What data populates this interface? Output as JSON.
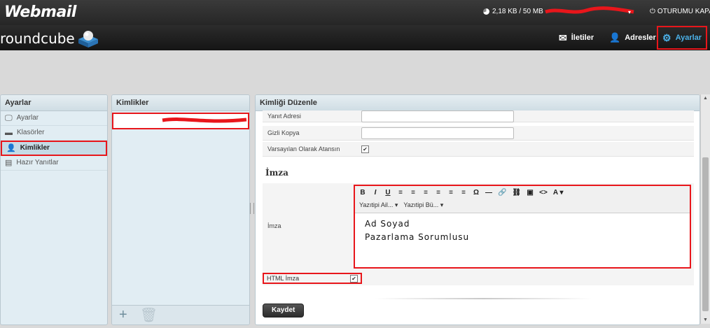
{
  "app": {
    "brand": "Webmail",
    "logo": "roundcube"
  },
  "topbar": {
    "quota": "2,18 KB / 50 MB",
    "logout": "OTURUMU KAPAT"
  },
  "nav": {
    "messages": "İletiler",
    "contacts": "Adresler",
    "settings": "Ayarlar"
  },
  "left_panel": {
    "title": "Ayarlar",
    "items": [
      {
        "label": "Ayarlar",
        "icon": "monitor-icon"
      },
      {
        "label": "Klasörler",
        "icon": "folder-icon"
      },
      {
        "label": "Kimlikler",
        "icon": "person-icon",
        "selected": true
      },
      {
        "label": "Hazır Yanıtlar",
        "icon": "document-icon"
      }
    ]
  },
  "mid_panel": {
    "title": "Kimlikler"
  },
  "right_panel": {
    "title": "Kimliği Düzenle",
    "fields": {
      "reply_to": "Yanıt Adresi",
      "bcc": "Gizli Kopya",
      "default": "Varsayılan Olarak Atansın"
    },
    "section_title": "İmza",
    "signature_label": "İmza",
    "toolbar": {
      "row1": [
        "B",
        "I",
        "U",
        "≡",
        "≡",
        "≡",
        "≡",
        "≡",
        "≡",
        "Ω",
        "—",
        "🔗",
        "⛓",
        "▣",
        "<>",
        "A ▾"
      ],
      "font_family": "Yazıtipi Ail...",
      "font_size": "Yazıtipi Bü..."
    },
    "signature_lines": [
      "Ad Soyad",
      "Pazarlama Sorumlusu"
    ],
    "html_signature_label": "HTML İmza",
    "save_label": "Kaydet"
  },
  "colors": {
    "accent": "#4cb1e8",
    "highlight": "#e8161b",
    "panel_bg": "#e1edf3"
  }
}
